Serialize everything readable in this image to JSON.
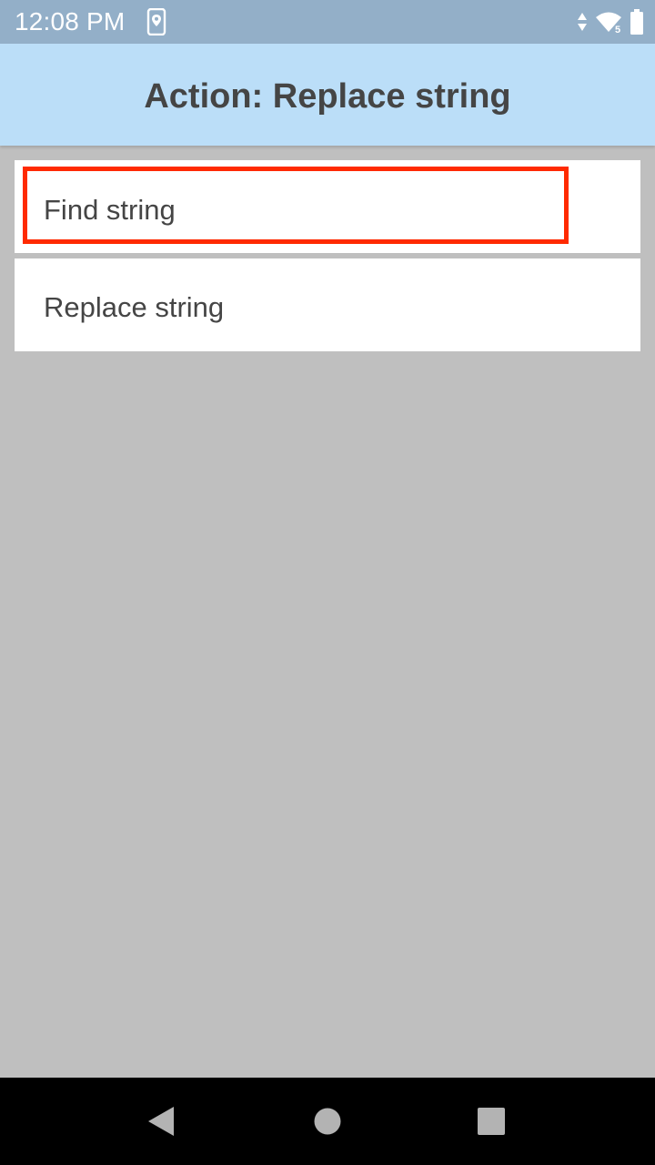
{
  "status_bar": {
    "time": "12:08 PM",
    "left_icons": [
      "location-icon"
    ],
    "right_icons": [
      "data-arrows-icon",
      "wifi-icon",
      "battery-icon"
    ],
    "wifi_badge": "5"
  },
  "app_bar": {
    "title": "Action: Replace string"
  },
  "list": {
    "items": [
      {
        "label": "Find string",
        "highlighted": true
      },
      {
        "label": "Replace string",
        "highlighted": false
      }
    ]
  },
  "nav_bar": {
    "buttons": [
      "back-icon",
      "home-icon",
      "recents-icon"
    ]
  },
  "colors": {
    "status_bar": "#93afc8",
    "app_bar": "#bbdef8",
    "background": "#bfbfbf",
    "highlight": "#ff2a00",
    "text": "#454545"
  }
}
